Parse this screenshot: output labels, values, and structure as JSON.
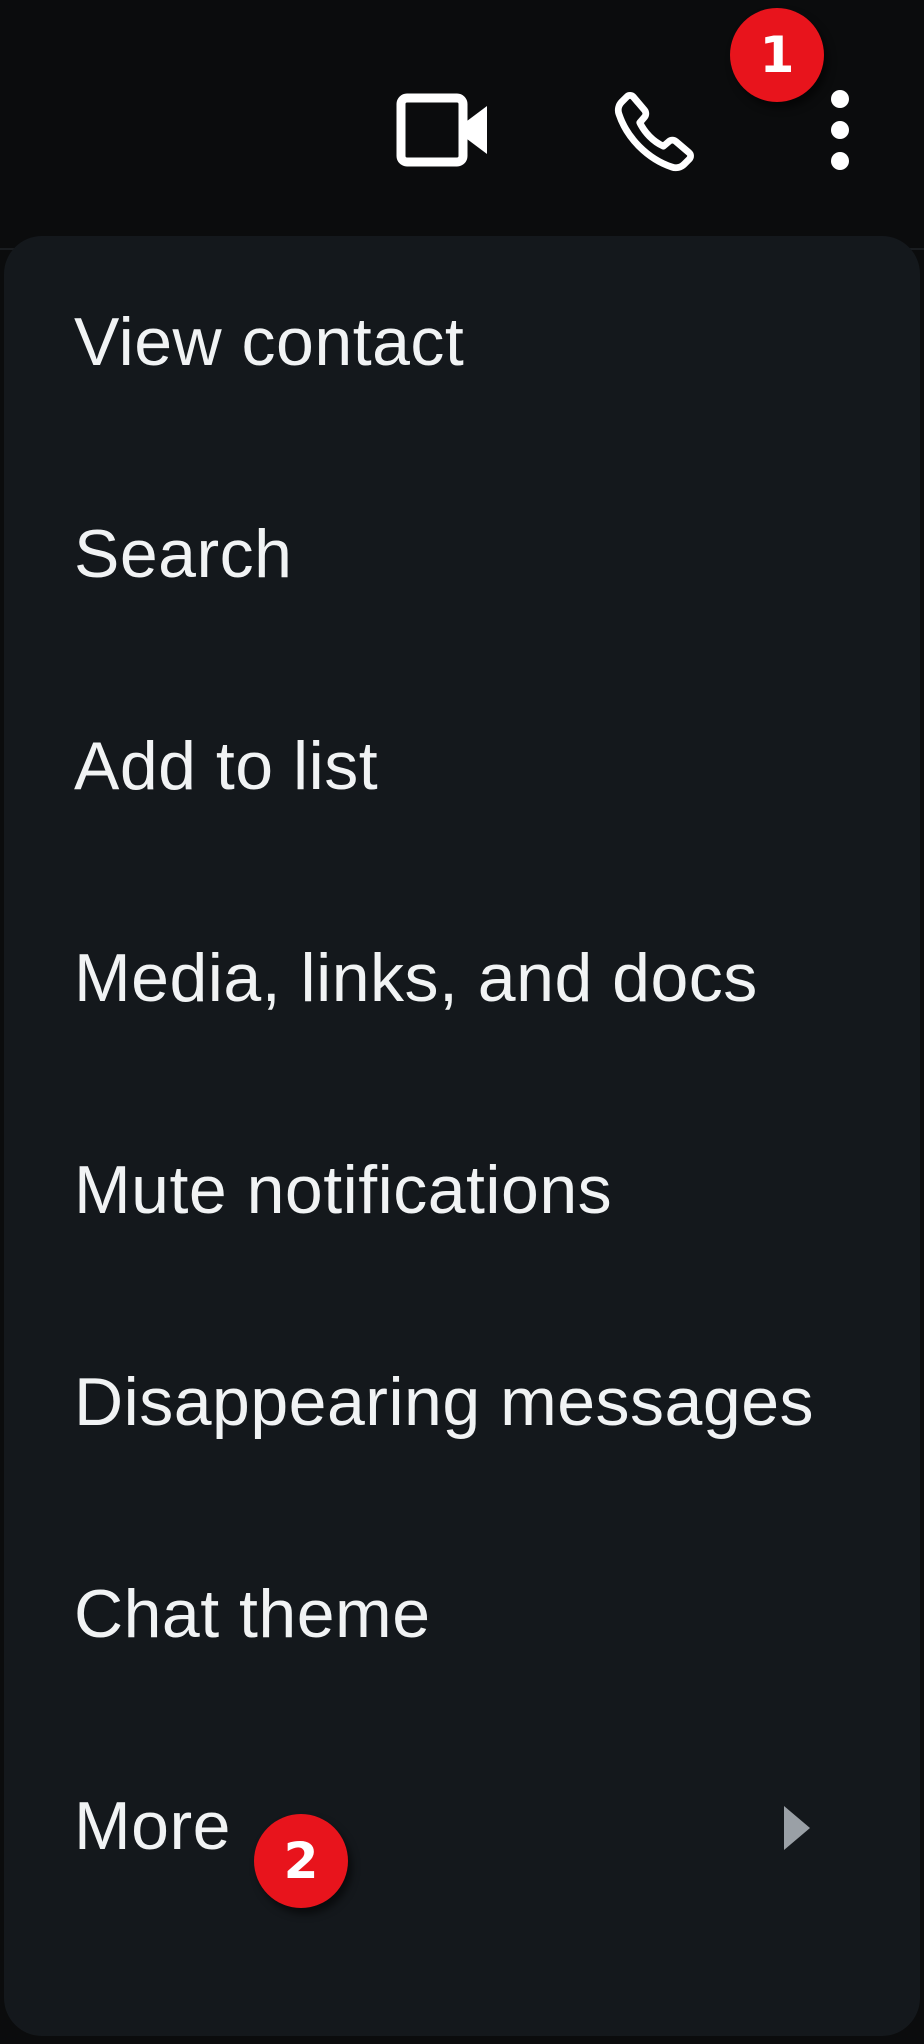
{
  "toolbar": {
    "video_call_icon": "video-camera-icon",
    "voice_call_icon": "phone-icon",
    "more_options_icon": "vertical-dots-icon"
  },
  "annotations": {
    "badge_1": "1",
    "badge_2": "2",
    "badge_color": "#e8141c"
  },
  "menu": {
    "items": [
      {
        "label": "View contact"
      },
      {
        "label": "Search"
      },
      {
        "label": "Add to list"
      },
      {
        "label": "Media, links, and docs"
      },
      {
        "label": "Mute notifications"
      },
      {
        "label": "Disappearing messages"
      },
      {
        "label": "Chat theme"
      },
      {
        "label": "More",
        "submenu_icon": "chevron-right-icon"
      }
    ]
  },
  "colors": {
    "background": "#0b0c0d",
    "menu_background": "#14181c",
    "text": "#f1f3f4"
  }
}
